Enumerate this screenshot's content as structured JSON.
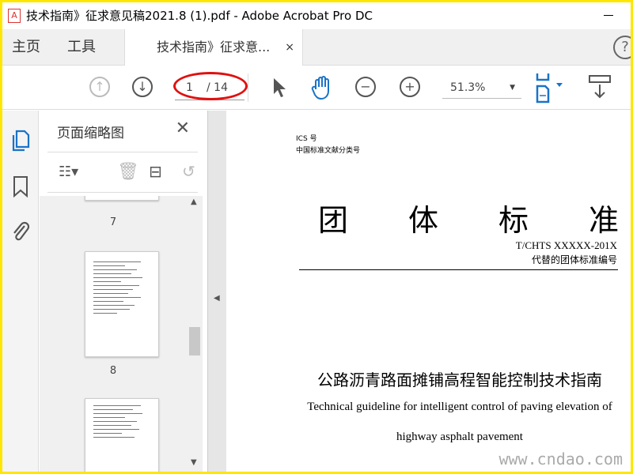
{
  "window": {
    "title": "技术指南》征求意见稿2021.8 (1).pdf - Adobe Acrobat Pro DC"
  },
  "tabs": {
    "home": "主页",
    "tools": "工具",
    "document": "技术指南》征求意...",
    "close": "×",
    "help": "?"
  },
  "toolbar": {
    "current_page": "1",
    "total_pages": "/ 14",
    "zoom": "51.3%",
    "annotation_color": "#e01010"
  },
  "panel": {
    "title": "页面缩略图",
    "close": "✕",
    "pages": [
      "7",
      "8"
    ]
  },
  "document": {
    "ics": "ICS 号",
    "classification": "中国标准文献分类号",
    "heading": [
      "团",
      "体",
      "标",
      "准"
    ],
    "code": "T/CHTS XXXXX-201X",
    "replace": "代替的团体标准编号",
    "title_cn": "公路沥青路面摊铺高程智能控制技术指南",
    "title_en_1": "Technical guideline for intelligent control of paving elevation of",
    "title_en_2": "highway asphalt pavement"
  },
  "watermark": "www.cndao.com"
}
